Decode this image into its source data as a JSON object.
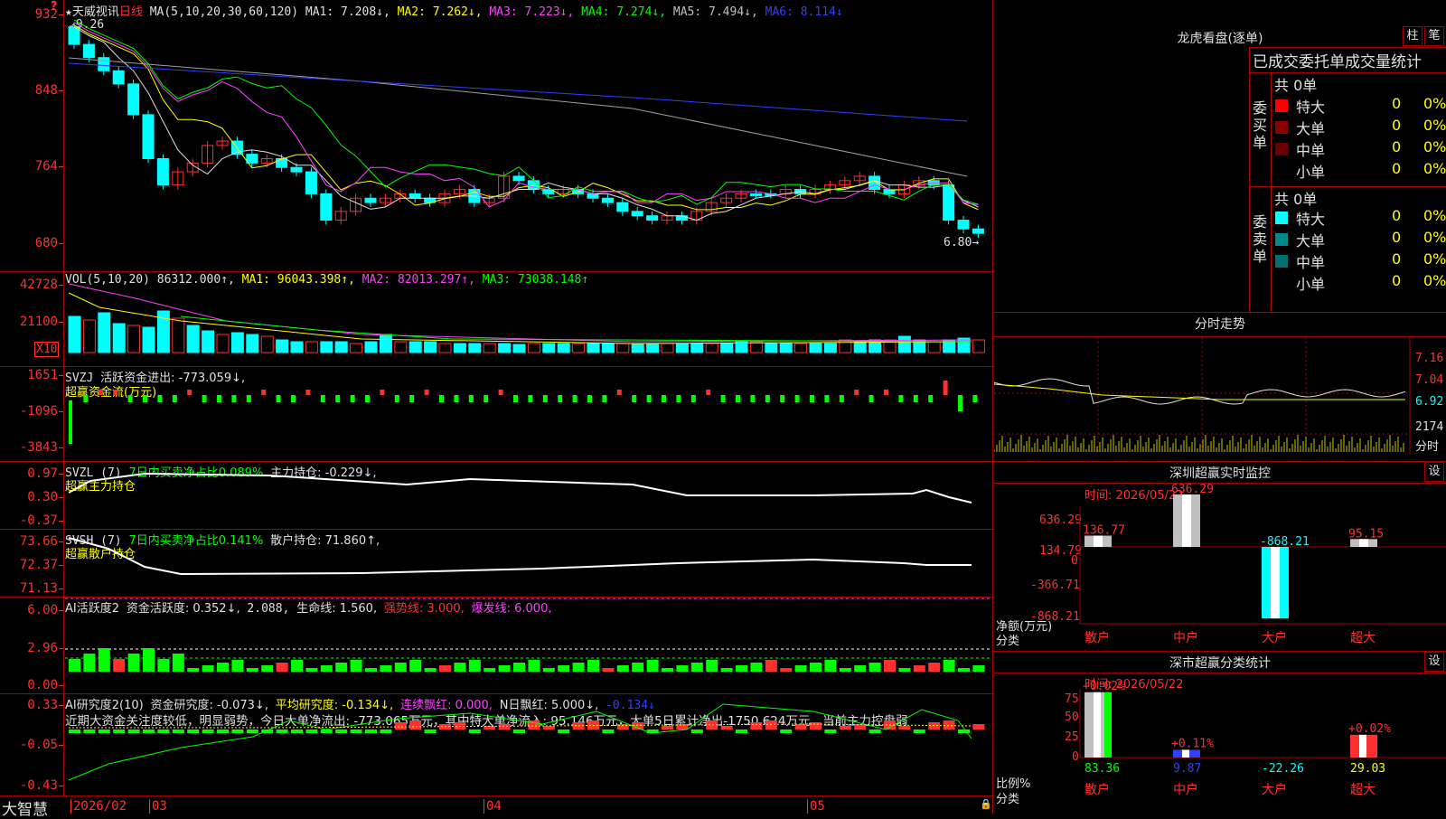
{
  "colors": {
    "up": "#ff3030",
    "down": "#00ffff",
    "ma1": "#e0e0e0",
    "ma2": "#ffff00",
    "ma3": "#ff40ff",
    "ma4": "#00ff00",
    "ma5": "#a0a0a0",
    "ma6": "#3040ff",
    "grid": "#a00000"
  },
  "main": {
    "star": "★",
    "name": "天威视讯",
    "period": "日线",
    "ma_label": "MA(5,10,20,30,60,120)",
    "ma1": "MA1: 7.208↓,",
    "ma2": "MA2: 7.262↓,",
    "ma3": "MA3: 7.223↓,",
    "ma4": "MA4: 7.274↓,",
    "ma5": "MA5: 7.494↓,",
    "ma6": "MA6: 8.114↓",
    "high_label": "9.26",
    "low_label": "6.80",
    "y_ticks": [
      "932",
      "848",
      "764",
      "680"
    ]
  },
  "vol": {
    "label": "VOL(5,10,20)",
    "value": "86312.000↑,",
    "ma1": "MA1: 96043.398↑,",
    "ma2": "MA2: 82013.297↑,",
    "ma3": "MA3: 73038.148↑",
    "y_ticks": [
      "42728",
      "21100"
    ],
    "unit": "X10"
  },
  "svzj": {
    "label": "SVZJ",
    "text": "活跃资金进出: -773.059↓,",
    "sub": "超赢资金流(万元)",
    "y_ticks": [
      "1651",
      "-1096",
      "-3843"
    ]
  },
  "svzl": {
    "label": "SVZL (7)",
    "ratio": "7日内买卖净占比0.089%",
    "hold": "主力持仓: -0.229↓,",
    "sub": "超赢主力持仓",
    "y_ticks": [
      "0.97",
      "0.30",
      "-0.37"
    ]
  },
  "svsh": {
    "label": "SVSH (7)",
    "ratio": "7日内买卖净占比0.141%",
    "hold": "散户持仓: 71.860↑,",
    "sub": "超赢散户持仓",
    "y_ticks": [
      "73.66",
      "72.37",
      "71.13"
    ]
  },
  "ai1": {
    "label": "AI活跃度2",
    "v1": "资金活跃度: 0.352↓,",
    "v2": "2.088,",
    "v3": "生命线: 1.560,",
    "v4": "强势线: 3.000,",
    "v5": "爆发线: 6.000,",
    "y_ticks": [
      "6.00",
      "2.96",
      "0.00"
    ]
  },
  "ai2": {
    "label": "AI研究度2(10)",
    "v1": "资金研究度: -0.073↓,",
    "v2": "平均研究度: -0.134↓,",
    "v3": "连续飘红: 0.000,",
    "v4": "N日飘红: 5.000↓,",
    "v5": "-0.134↓",
    "comment": "近期大资金关注度较低，明显弱势，今日大单净流出: -773.065万元，其中特大单净流入: 95.146万元，大单5日累计净出-1750.624万元，当前主力控盘弱",
    "y_ticks": [
      "0.33",
      "-0.05",
      "-0.43"
    ]
  },
  "bottom": {
    "brand": "大智慧",
    "date_labels": [
      "2026/02",
      "03",
      "04",
      "05"
    ]
  },
  "lhb": {
    "title": "龙虎看盘(逐单)",
    "btn1": "柱",
    "btn2": "笔",
    "header": "已成交委托单成交量统计",
    "buy_label": "委买单",
    "sell_label": "委卖单",
    "buy_total": "共 0单",
    "sell_total": "共 0单",
    "buy_rows": [
      {
        "name": "特大",
        "count": "0",
        "pct": "0%",
        "color": "#ff0000"
      },
      {
        "name": "大单",
        "count": "0",
        "pct": "0%",
        "color": "#8b0000"
      },
      {
        "name": "中单",
        "count": "0",
        "pct": "0%",
        "color": "#6b0000"
      },
      {
        "name": "小单",
        "count": "0",
        "pct": "0%",
        "color": "#000000"
      }
    ],
    "sell_rows": [
      {
        "name": "特大",
        "count": "0",
        "pct": "0%",
        "color": "#00ffff"
      },
      {
        "name": "大单",
        "count": "0",
        "pct": "0%",
        "color": "#008b8b"
      },
      {
        "name": "中单",
        "count": "0",
        "pct": "0%",
        "color": "#007070"
      },
      {
        "name": "小单",
        "count": "0",
        "pct": "0%",
        "color": "#000000"
      }
    ]
  },
  "intraday": {
    "title": "分时走势",
    "y_ticks": [
      "7.16",
      "7.04",
      "6.92"
    ],
    "vol_tick": "2174",
    "vol_label": "分时"
  },
  "monitor": {
    "title": "深圳超赢实时监控",
    "btn": "设",
    "date": "时间: 2026/05/22",
    "y_ticks": [
      "636.29",
      "134.79",
      "0",
      "-366.71",
      "-868.21"
    ],
    "bars": [
      {
        "cat": "散户",
        "val": "136.77"
      },
      {
        "cat": "中户",
        "val": "636.29"
      },
      {
        "cat": "大户",
        "val": "-868.21"
      },
      {
        "cat": "超大",
        "val": "95.15"
      }
    ],
    "axis_name": "净额(万元)",
    "axis_cat": "分类"
  },
  "classify": {
    "title": "深市超赢分类统计",
    "btn": "设",
    "date": "时间: 2026/05/22",
    "y_ticks": [
      "75",
      "50",
      "25",
      "0"
    ],
    "bars": [
      {
        "cat": "散户",
        "top": "+0.02%",
        "bot": "83.36"
      },
      {
        "cat": "中户",
        "top": "+0.11%",
        "bot": "9.87"
      },
      {
        "cat": "大户",
        "top": "",
        "bot": "-22.26"
      },
      {
        "cat": "超大",
        "top": "+0.02%",
        "bot": "29.03"
      }
    ],
    "axis_name": "比例%",
    "axis_cat": "分类"
  }
}
